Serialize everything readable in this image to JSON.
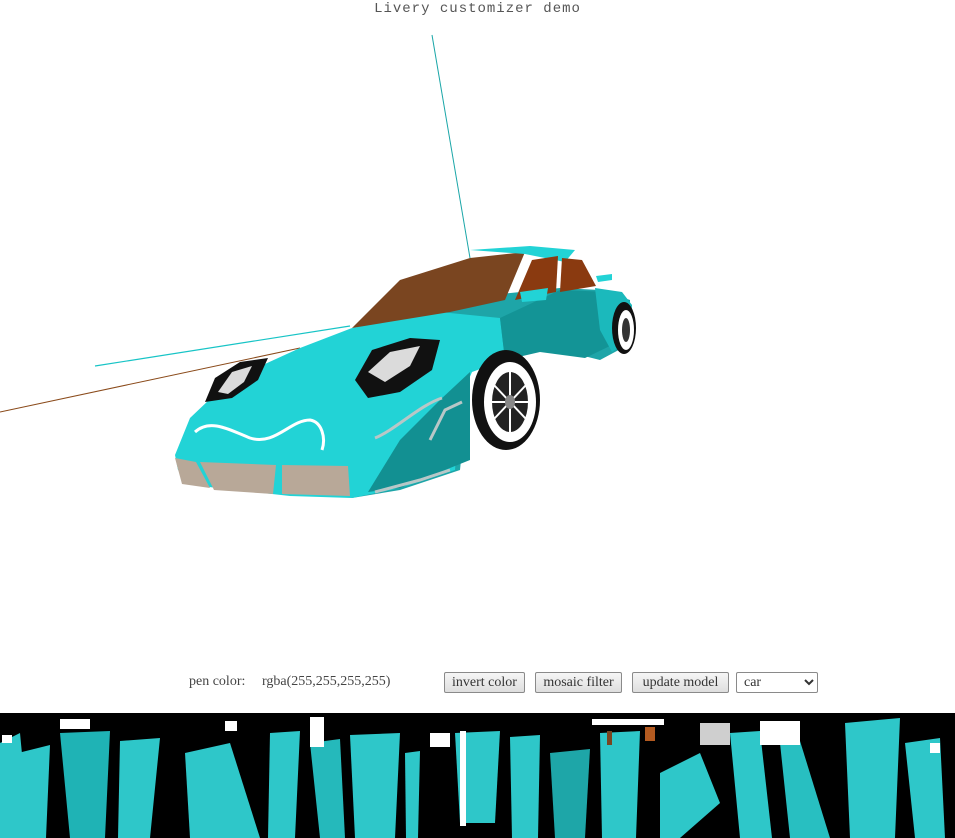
{
  "page": {
    "title": "Livery customizer demo"
  },
  "controls": {
    "pen_color_label": "pen color:",
    "pen_color_value": "rgba(255,255,255,255)",
    "invert_label": "invert color",
    "mosaic_label": "mosaic filter",
    "update_label": "update model",
    "model_options": [
      "car"
    ],
    "model_selected": "car"
  },
  "colors": {
    "body_primary": "#22d3d6",
    "body_shadow": "#108a8c",
    "roof": "#7a4520",
    "interior": "#8a3a10",
    "tire": "#111111",
    "rim": "#ffffff",
    "grille": "#b8a898",
    "strip_background": "#000000",
    "strip_accent": "#2ec7c9"
  },
  "scene": {
    "object": "car",
    "view": "3d-preview",
    "texture_strip": "uv-texture-map"
  }
}
